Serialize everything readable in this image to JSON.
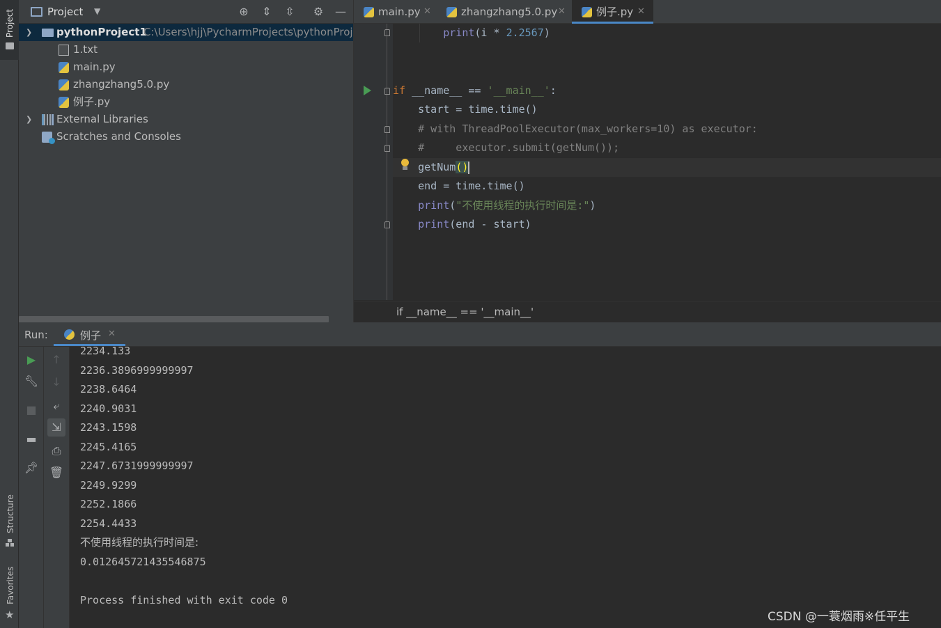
{
  "side_tabs": {
    "project": "Project",
    "structure": "Structure",
    "favorites": "Favorites"
  },
  "project_panel": {
    "title": "Project",
    "tree": [
      {
        "label": "pythonProject1",
        "path": "C:\\Users\\hjj\\PycharmProjects\\pythonProje",
        "type": "folder",
        "expanded": true
      },
      {
        "label": "1.txt",
        "type": "text-file"
      },
      {
        "label": "main.py",
        "type": "python-file"
      },
      {
        "label": "zhangzhang5.0.py",
        "type": "python-file"
      },
      {
        "label": "例子.py",
        "type": "python-file"
      },
      {
        "label": "External Libraries",
        "type": "libraries"
      },
      {
        "label": "Scratches and Consoles",
        "type": "scratches"
      }
    ]
  },
  "editor": {
    "tabs": [
      {
        "label": "main.py",
        "active": false
      },
      {
        "label": "zhangzhang5.0.py",
        "active": false
      },
      {
        "label": "例子.py",
        "active": true
      }
    ],
    "breadcrumb": "if __name__ == '__main__'"
  },
  "run_panel": {
    "label": "Run:",
    "tab": "例子",
    "output": [
      "2234.133",
      "2236.3896999999997",
      "2238.6464",
      "2240.9031",
      "2243.1598",
      "2245.4165",
      "2247.6731999999997",
      "2249.9299",
      "2252.1866",
      "2254.4433",
      "不使用线程的执行时间是:",
      "0.012645721435546875",
      "",
      "Process finished with exit code 0"
    ]
  },
  "watermark": "CSDN @一蓑烟雨※任平生",
  "colors": {
    "background": "#2b2b2b",
    "panel": "#3c3f41",
    "selection": "#0d293e",
    "accent": "#4a88c7",
    "keyword": "#cc7832",
    "builtin": "#8888c6",
    "number": "#6897bb",
    "string": "#6a8759",
    "comment": "#808080",
    "run": "#499c54"
  }
}
